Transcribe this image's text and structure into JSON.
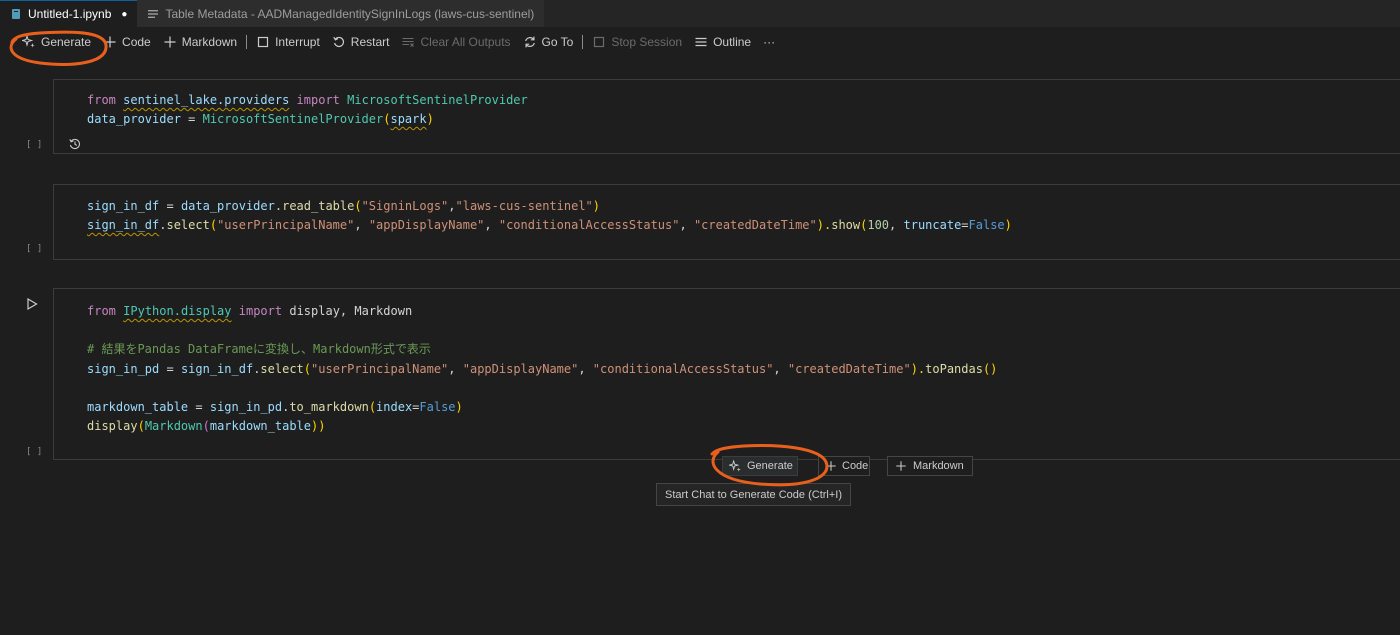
{
  "tabs": [
    {
      "label": "Untitled-1.ipynb",
      "dirty_marker": "●",
      "icon": "notebook-icon"
    },
    {
      "label": "Table Metadata - AADManagedIdentitySignInLogs (laws-cus-sentinel)",
      "icon": "list-icon"
    }
  ],
  "toolbar": {
    "generate": "Generate",
    "code": "Code",
    "markdown": "Markdown",
    "interrupt": "Interrupt",
    "restart": "Restart",
    "clear_all_outputs": "Clear All Outputs",
    "go_to": "Go To",
    "stop_session": "Stop Session",
    "outline": "Outline",
    "more": "···"
  },
  "cells": [
    {
      "exec": "[ ]"
    },
    {
      "exec": "[ ]"
    },
    {
      "exec": "[ ]"
    }
  ],
  "code": {
    "c1l1": [
      "from",
      "sentinel_lake.providers",
      "import",
      "MicrosoftSentinelProvider"
    ],
    "c1l2": [
      "data_provider",
      " = ",
      "MicrosoftSentinelProvider",
      "(",
      "spark",
      ")"
    ],
    "c2l1": [
      "sign_in_df",
      " = ",
      "data_provider",
      ".",
      "read_table",
      "(",
      "\"SigninLogs\"",
      ",",
      "\"laws-cus-sentinel\"",
      ")"
    ],
    "c2l2": [
      "sign_in_df",
      ".",
      "select",
      "(",
      "\"userPrincipalName\"",
      ", ",
      "\"appDisplayName\"",
      ", ",
      "\"conditionalAccessStatus\"",
      ", ",
      "\"createdDateTime\"",
      ").",
      "show",
      "(",
      "100",
      ", ",
      "truncate",
      "=",
      "False",
      ")"
    ],
    "c3l1": [
      "from",
      "IPython.display",
      "import",
      "display, Markdown"
    ],
    "c3l3": "# 結果をPandas DataFrameに変換し、Markdown形式で表示",
    "c3l4": [
      "sign_in_pd",
      " = ",
      "sign_in_df",
      ".",
      "select",
      "(",
      "\"userPrincipalName\"",
      ", ",
      "\"appDisplayName\"",
      ", ",
      "\"conditionalAccessStatus\"",
      ", ",
      "\"createdDateTime\"",
      ").",
      "toPandas",
      "()"
    ],
    "c3l6": [
      "markdown_table",
      " = ",
      "sign_in_pd",
      ".",
      "to_markdown",
      "(",
      "index",
      "=",
      "False",
      ")"
    ],
    "c3l7": [
      "display",
      "(",
      "Markdown",
      "(",
      "markdown_table",
      "))"
    ]
  },
  "insert_bar": {
    "generate": "Generate",
    "code": "Code",
    "markdown": "Markdown",
    "tooltip": "Start Chat to Generate Code (Ctrl+I)"
  },
  "colors": {
    "annotation": "#e8601c",
    "keyword": "#c586c0",
    "string": "#ce9178",
    "function": "#dcdcaa",
    "variable": "#9cdcfe",
    "comment": "#6a9955"
  }
}
